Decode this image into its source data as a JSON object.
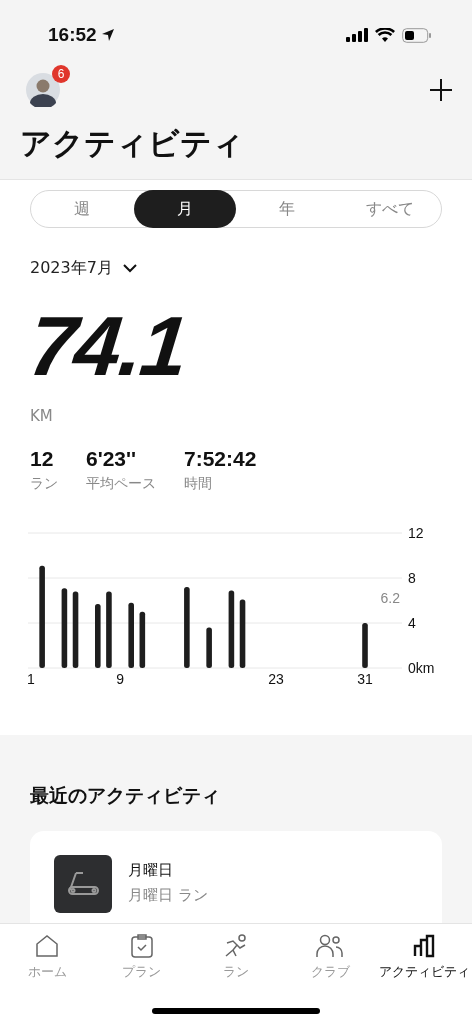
{
  "status_bar": {
    "time": "16:52"
  },
  "header": {
    "badge": "6",
    "title": "アクティビティ"
  },
  "segments": [
    {
      "label": "週",
      "selected": false
    },
    {
      "label": "月",
      "selected": true
    },
    {
      "label": "年",
      "selected": false
    },
    {
      "label": "すべて",
      "selected": false
    }
  ],
  "period": "2023年7月",
  "total": {
    "value": "74.1",
    "unit": "KM"
  },
  "stats": [
    {
      "value": "12",
      "label": "ラン"
    },
    {
      "value": "6'23''",
      "label": "平均ペース"
    },
    {
      "value": "7:52:42",
      "label": "時間"
    }
  ],
  "chart_data": {
    "type": "bar",
    "x": [
      2,
      4,
      5,
      7,
      8,
      10,
      11,
      15,
      17,
      19,
      20,
      31
    ],
    "values": [
      9.1,
      7.1,
      6.8,
      5.7,
      6.8,
      5.8,
      5.0,
      7.2,
      3.6,
      6.9,
      6.1,
      4.0
    ],
    "xlim": [
      1,
      31
    ],
    "xticks": [
      1,
      9,
      23,
      31
    ],
    "yticks": [
      {
        "value": 0,
        "label": "0km"
      },
      4,
      8,
      12
    ],
    "ylim": [
      0,
      12
    ],
    "annotations": [
      "6.2"
    ]
  },
  "recent": {
    "heading": "最近のアクティビティ",
    "items": [
      {
        "title": "月曜日",
        "subtitle": "月曜日 ラン"
      }
    ]
  },
  "nav": [
    {
      "kind": "home",
      "label": "ホーム",
      "selected": false
    },
    {
      "kind": "plan",
      "label": "プラン",
      "selected": false
    },
    {
      "kind": "run",
      "label": "ラン",
      "selected": false
    },
    {
      "kind": "club",
      "label": "クラブ",
      "selected": false
    },
    {
      "kind": "activity",
      "label": "アクティビティ",
      "selected": true
    }
  ]
}
